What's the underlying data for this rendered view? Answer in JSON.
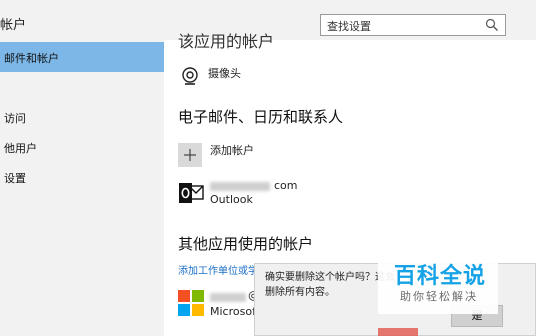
{
  "window": {
    "title": "帐户"
  },
  "search": {
    "placeholder": "查找设置"
  },
  "sidebar": {
    "items": [
      {
        "label": "邮件和帐户"
      },
      {
        "label": ""
      },
      {
        "label": "访问"
      },
      {
        "label": "他用户"
      },
      {
        "label": "设置"
      }
    ]
  },
  "main": {
    "cut_heading": "该应用的帐户",
    "camera_label": "摄像头",
    "section_email": "电子邮件、日历和联系人",
    "add_account": "添加帐户",
    "outlook": {
      "email_suffix": "com",
      "provider": "Outlook"
    },
    "section_other": "其他应用使用的帐户",
    "work_link": "添加工作单位或学校",
    "microsoft": {
      "email_suffix": "@",
      "provider": "Microsoft"
    }
  },
  "dialog": {
    "message": "确实要删除这个帐户吗？这会删除所有内容。",
    "confirm_label": "是"
  },
  "watermark": {
    "title": "百科全说",
    "subtitle": "助你轻松解决"
  },
  "colors": {
    "accent": "#7cb7e8",
    "link": "#1a6fc6",
    "watermark": "#16a2e6"
  }
}
